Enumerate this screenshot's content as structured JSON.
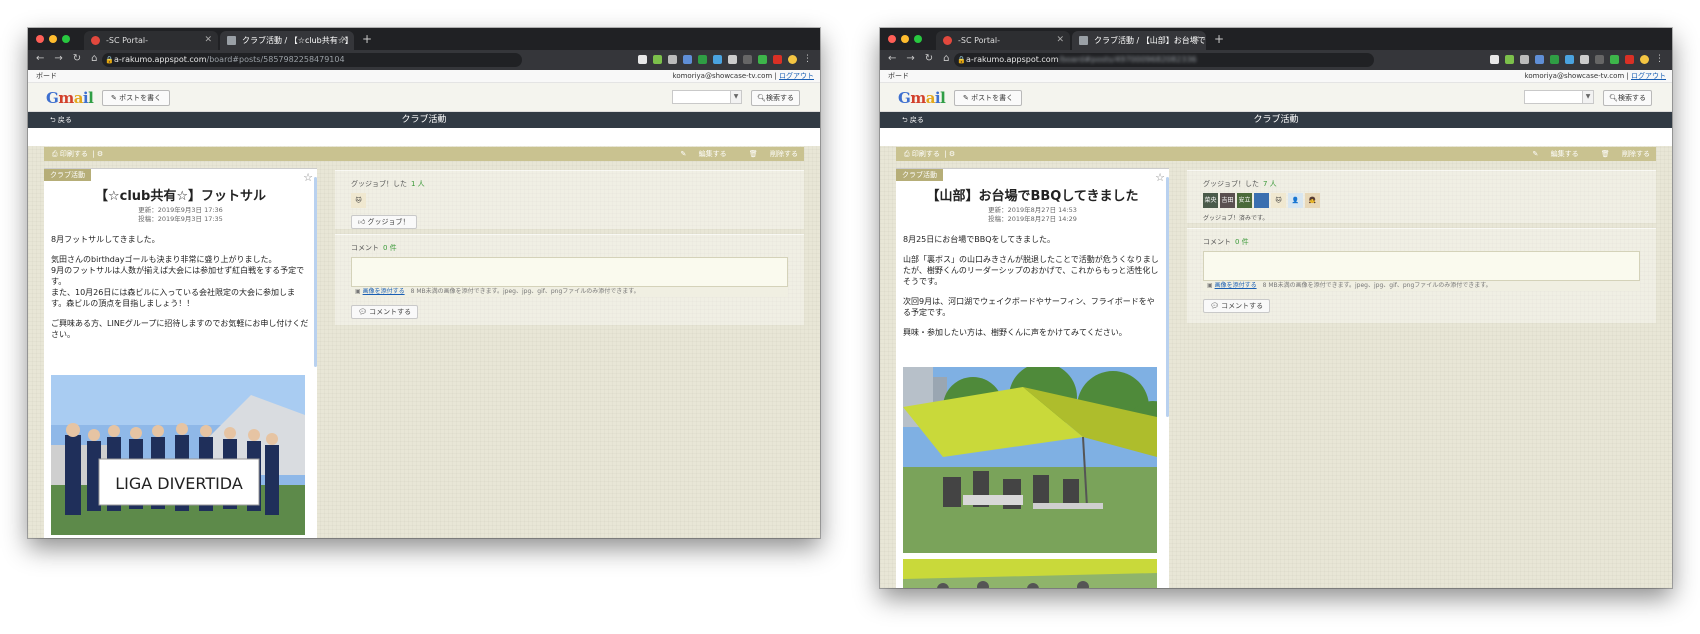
{
  "windows": [
    {
      "tabs": [
        {
          "label": "-SC Portal-"
        },
        {
          "label": "クラブ活動 / 【☆club共有☆】フ"
        }
      ],
      "url_host": "a-rakumo.appspot.com",
      "url_path": "/board#posts/5857982258479104",
      "gbar": {
        "app": "ボード",
        "user": "komoriya@showcase-tv.com",
        "logout": "ログアウト"
      },
      "header": {
        "post_button": "ポストを書く",
        "search_button": "検索する"
      },
      "titlebar": {
        "back": "戻る",
        "title": "クラブ活動"
      },
      "toolbar": {
        "print": "印刷する",
        "edit": "編集する",
        "delete": "削除する"
      },
      "post": {
        "category": "クラブ活動",
        "title": "【☆club共有☆】フットサル",
        "updated": "更新：2019年9月3日 17:36",
        "posted": "投稿：2019年9月3日 17:35",
        "paragraphs": [
          "8月フットサルしてきました。",
          "気田さんのbirthdayゴールも決まり非常に盛り上がりました。",
          "9月のフットサルは人数が揃えば大会には参加せず紅白戦をする予定です。",
          "また、10月26日には森ビルに入っている会社限定の大会に参加します。森ビルの頂点を目指しましょう！！",
          "ご興味ある方、LINEグループに招待しますのでお気軽にお申し付けください。"
        ],
        "banner_text": "LIGA DIVERTIDA"
      },
      "reaction": {
        "label": "グッジョブ！した",
        "count": "1 人",
        "button": "グッジョブ！",
        "note": ""
      },
      "comments": {
        "label": "コメント",
        "count": "0 件",
        "attach": "画像を添付する",
        "attach_note": "8 MB未満の画像を添付できます。jpeg、jpg、gif、pngファイルのみ添付できます。",
        "submit": "コメントする"
      }
    },
    {
      "tabs": [
        {
          "label": "-SC Portal-"
        },
        {
          "label": "クラブ活動 / 【山部】お台場でBB"
        }
      ],
      "url_host": "a-rakumo.appspot.com",
      "url_path": "/board#posts/4970009682082336",
      "gbar": {
        "app": "ボード",
        "user": "komoriya@showcase-tv.com",
        "logout": "ログアウト"
      },
      "header": {
        "post_button": "ポストを書く",
        "search_button": "検索する"
      },
      "titlebar": {
        "back": "戻る",
        "title": "クラブ活動"
      },
      "toolbar": {
        "print": "印刷する",
        "edit": "編集する",
        "delete": "削除する"
      },
      "post": {
        "category": "クラブ活動",
        "title": "【山部】お台場でBBQしてきました",
        "updated": "更新：2019年8月27日 14:53",
        "posted": "投稿：2019年8月27日 14:29",
        "paragraphs": [
          "8月25日にお台場でBBQをしてきました。",
          "山部「裏ボス」の山口みきさんが脱退したことで活動が危うくなりましたが、樹野くんのリーダーシップのおかげで、これからもっと活性化しそうです。",
          "次回9月は、河口湖でウェイクボードやサーフィン、フライボードをやる予定です。",
          "興味・参加したい方は、樹野くんに声をかけてみてください。"
        ],
        "banner_text": ""
      },
      "reaction": {
        "label": "グッジョブ！した",
        "count": "7 人",
        "button": "",
        "note": "グッジョブ！済みです。",
        "avatars": [
          "菜央",
          "吉田",
          "安立"
        ]
      },
      "comments": {
        "label": "コメント",
        "count": "0 件",
        "attach": "画像を添付する",
        "attach_note": "8 MB未満の画像を添付できます。jpeg、jpg、gif、pngファイルのみ添付できます。",
        "submit": "コメントする"
      }
    }
  ],
  "icons": [
    "back-arrow-icon",
    "forward-arrow-icon",
    "reload-icon",
    "home-icon",
    "lock-icon",
    "star-icon",
    "print-icon",
    "gear-icon",
    "edit-icon",
    "trash-icon",
    "pencil-icon",
    "search-icon",
    "thumbs-up-icon",
    "image-icon",
    "comment-icon"
  ]
}
